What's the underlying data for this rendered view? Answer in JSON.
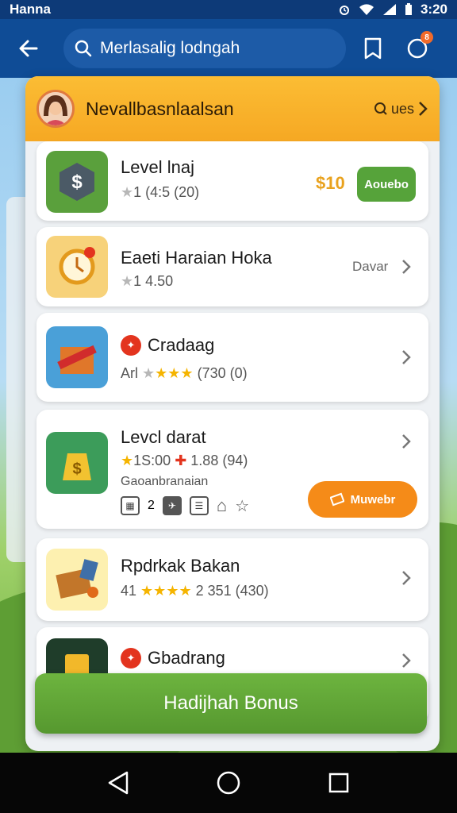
{
  "status_bar": {
    "carrier": "Hanna",
    "time": "3:20"
  },
  "app_bar": {
    "search_text": "Merlasalig lodngah",
    "notification_badge": "8"
  },
  "panel": {
    "title": "Nevallbasnlaalsan",
    "see_all": "ues"
  },
  "items": [
    {
      "name": "Level lnaj",
      "rating_text": "1 (4:5 (20)",
      "price": "$10",
      "action": "Aouebo"
    },
    {
      "name": "Eaeti Haraian Hoka",
      "rating_text": "1 4.50",
      "side_text": "Davar"
    },
    {
      "name": "Cradaag",
      "rating_prefix": "Arl",
      "rating_text": "(730 (0)"
    },
    {
      "name": "Levcl darat",
      "rating_text": "1S:00",
      "rating_extra": "1.88 (94)",
      "subtitle": "Gaoanbranaian",
      "action": "Muwebr",
      "mini_text": "2"
    },
    {
      "name": "Rpdrkak Bakan",
      "rating_prefix": "41",
      "rating_text": "2 351 (430)"
    },
    {
      "name": "Gbadrang"
    }
  ],
  "bonus_button": "Hadijhah Bonus",
  "colors": {
    "accent_orange": "#F6A823",
    "primary_blue": "#0F4C96",
    "green": "#56A33A"
  }
}
